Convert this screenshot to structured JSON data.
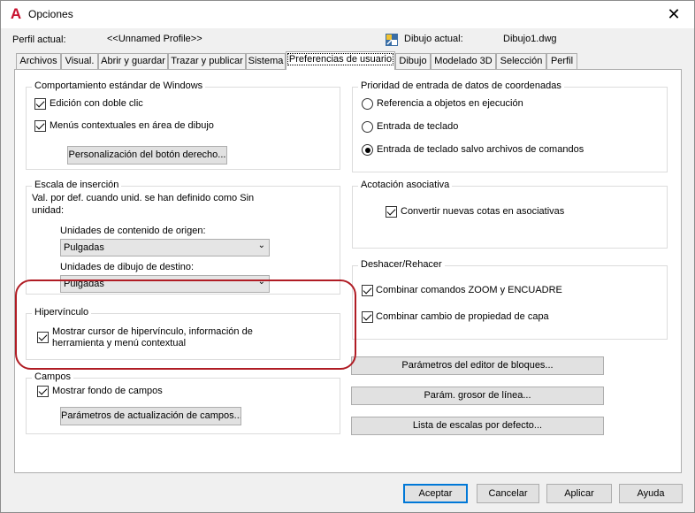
{
  "window": {
    "title": "Opciones",
    "app_icon": "A",
    "close_glyph": "✕"
  },
  "header": {
    "profile_label": "Perfil actual:",
    "profile_value": "<<Unnamed Profile>>",
    "drawing_label": "Dibujo actual:",
    "drawing_value": "Dibujo1.dwg"
  },
  "tabs": [
    {
      "label": "Archivos"
    },
    {
      "label": "Visual."
    },
    {
      "label": "Abrir y guardar"
    },
    {
      "label": "Trazar y publicar"
    },
    {
      "label": "Sistema"
    },
    {
      "label": "Preferencias de usuario",
      "active": true
    },
    {
      "label": "Dibujo"
    },
    {
      "label": "Modelado 3D"
    },
    {
      "label": "Selección"
    },
    {
      "label": "Perfil"
    }
  ],
  "windows_behavior": {
    "title": "Comportamiento estándar de Windows",
    "double_click_edit": "Edición con doble clic",
    "context_menus": "Menús contextuales en área de dibujo",
    "right_click_button": "Personalización del botón derecho..."
  },
  "insertion_scale": {
    "title": "Escala de inserción",
    "description": "Val. por def. cuando unid. se han definido como Sin unidad:",
    "source_label": "Unidades de contenido de origen:",
    "source_value": "Pulgadas",
    "target_label": "Unidades de dibujo de destino:",
    "target_value": "Pulgadas"
  },
  "hyperlink": {
    "title": "Hipervínculo",
    "option": "Mostrar cursor de hipervínculo, información de herramienta y menú contextual"
  },
  "fields": {
    "title": "Campos",
    "show_background": "Mostrar fondo de campos",
    "update_button": "Parámetros de actualización de campos..."
  },
  "coordinate_priority": {
    "title": "Prioridad de entrada de datos de coordenadas",
    "options": [
      {
        "label": "Referencia a objetos en ejecución",
        "selected": false
      },
      {
        "label": "Entrada de teclado",
        "selected": false
      },
      {
        "label": "Entrada de teclado salvo archivos de comandos",
        "selected": true
      }
    ]
  },
  "associative_dim": {
    "title": "Acotación asociativa",
    "option": "Convertir nuevas cotas en asociativas"
  },
  "undo_redo": {
    "title": "Deshacer/Rehacer",
    "combine_zoom": "Combinar comandos ZOOM y ENCUADRE",
    "combine_layer": "Combinar cambio de propiedad de capa"
  },
  "right_buttons": {
    "block_editor": "Parámetros del editor de bloques...",
    "lineweight": "Parám. grosor de línea...",
    "scale_list": "Lista de escalas por defecto..."
  },
  "footer": {
    "accept": "Aceptar",
    "cancel": "Cancelar",
    "apply": "Aplicar",
    "help": "Ayuda"
  },
  "colors": {
    "highlight": "#b01c24",
    "accent": "#0078d7"
  }
}
